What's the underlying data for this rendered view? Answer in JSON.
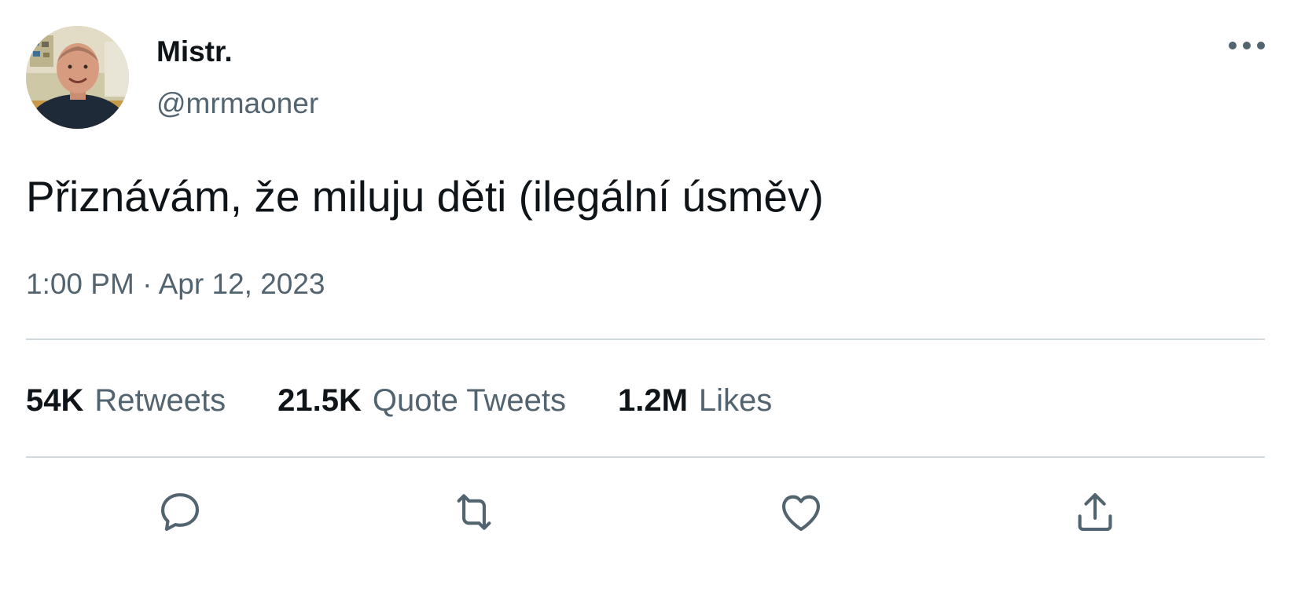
{
  "user": {
    "display_name": "Mistr.",
    "handle": "@mrmaoner",
    "avatar_icon": "profile-photo"
  },
  "tweet": {
    "text": "Přiznávám, že miluju děti (ilegální úsměv)",
    "timestamp": "1:00 PM · Apr 12, 2023"
  },
  "stats": [
    {
      "count": "54K",
      "label": "Retweets"
    },
    {
      "count": "21.5K",
      "label": "Quote Tweets"
    },
    {
      "count": "1.2M",
      "label": "Likes"
    }
  ],
  "actions": [
    {
      "icon": "reply-icon"
    },
    {
      "icon": "retweet-icon"
    },
    {
      "icon": "like-icon"
    },
    {
      "icon": "share-icon"
    }
  ],
  "menu": {
    "icon": "more-options-icon"
  },
  "colors": {
    "text": "#0f1419",
    "secondary": "#536471",
    "divider": "#cfd9de",
    "background": "#ffffff"
  }
}
